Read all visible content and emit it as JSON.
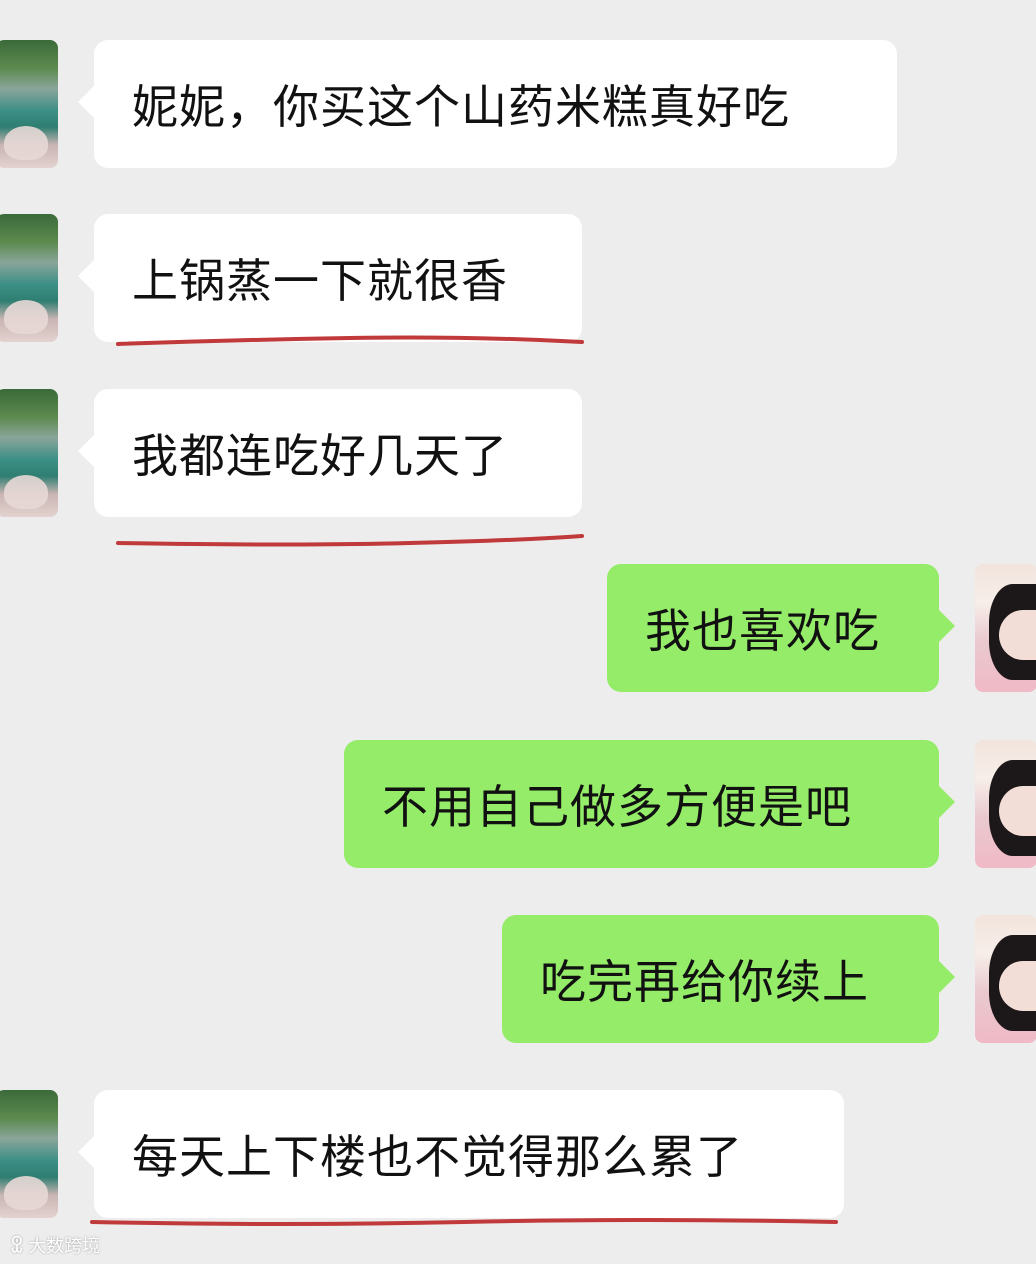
{
  "messages": [
    {
      "side": "in",
      "text": "妮妮，你买这个山药米糕真好吃"
    },
    {
      "side": "in",
      "text": "上锅蒸一下就很香"
    },
    {
      "side": "in",
      "text": "我都连吃好几天了"
    },
    {
      "side": "out",
      "text": "我也喜欢吃"
    },
    {
      "side": "out",
      "text": "不用自己做多方便是吧"
    },
    {
      "side": "out",
      "text": "吃完再给你续上"
    },
    {
      "side": "in",
      "text": "每天上下楼也不觉得那么累了"
    }
  ],
  "watermark": {
    "logo": "ꀾ",
    "text": "大数跨境"
  },
  "colors": {
    "background": "#ededed",
    "incoming_bubble": "#ffffff",
    "outgoing_bubble": "#95ec69",
    "underline": "#c0393b"
  },
  "icons": {
    "contact_avatar": "landscape-photo-avatar",
    "self_avatar": "girl-photo-avatar"
  }
}
